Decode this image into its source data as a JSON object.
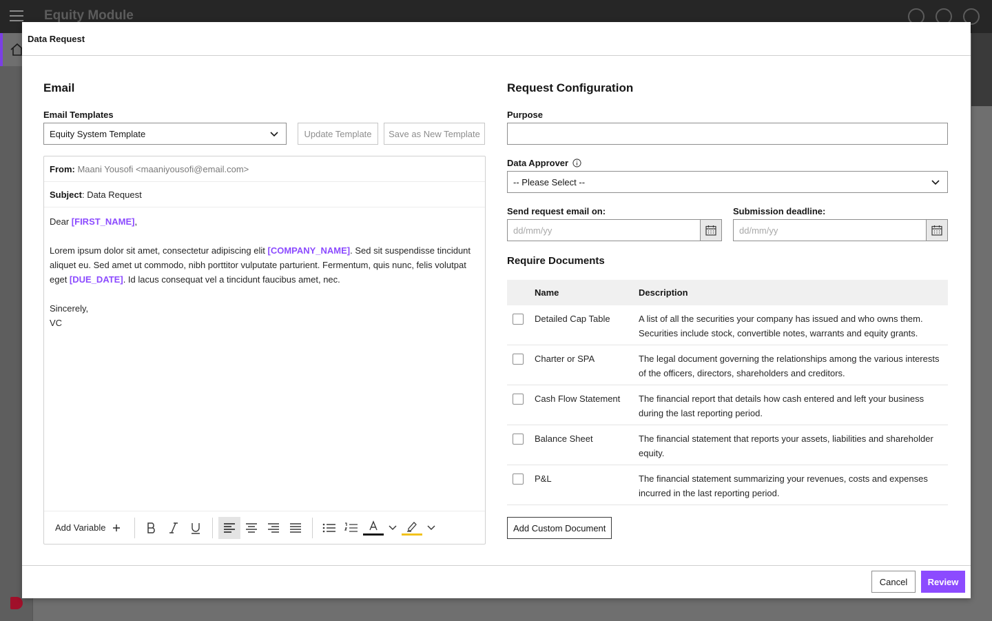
{
  "app": {
    "title": "Equity Module"
  },
  "modal": {
    "title": "Data Request",
    "cancel_label": "Cancel",
    "review_label": "Review"
  },
  "email": {
    "section_title": "Email",
    "templates_label": "Email Templates",
    "template_selected": "Equity System Template",
    "update_template_label": "Update Template",
    "save_template_label": "Save as New Template",
    "from_label": "From:",
    "from_value": "Maani Yousofi <maaniyousofi@email.com>",
    "subject_label": "Subject",
    "subject_value": ": Data Request",
    "greeting": "Dear ",
    "var_first_name": "[FIRST_NAME]",
    "greeting_end": ",",
    "body_part1": "Lorem ipsum dolor sit amet, consectetur adipiscing elit ",
    "var_company_name": "[COMPANY_NAME]",
    "body_part2": ". Sed sit suspendisse tincidunt aliquet eu. Sed amet ut commodo, nibh porttitor vulputate parturient. Fermentum, quis nunc, felis volutpat eget ",
    "var_due_date": "[DUE_DATE]",
    "body_part3": ". Id lacus consequat vel a tincidunt faucibus amet, nec.",
    "closing": "Sincerely,",
    "signature": "VC",
    "toolbar": {
      "add_variable_label": "Add Variable",
      "text_color": "#161616",
      "highlight_color": "#f1c21b"
    }
  },
  "config": {
    "section_title": "Request Configuration",
    "purpose_label": "Purpose",
    "purpose_value": "",
    "approver_label": "Data Approver",
    "approver_selected": "-- Please Select --",
    "send_on_label": "Send request email on:",
    "send_on_placeholder": "dd/mm/yy",
    "deadline_label": "Submission deadline:",
    "deadline_placeholder": "dd/mm/yy",
    "docs_title": "Require Documents",
    "col_name": "Name",
    "col_description": "Description",
    "documents": [
      {
        "name": "Detailed Cap Table",
        "description": "A list of all the securities your company has issued and who owns them. Securities include stock, convertible notes, warrants and equity grants."
      },
      {
        "name": "Charter or SPA",
        "description": "The legal document governing the relationships among the various interests of the officers, directors, shareholders and creditors."
      },
      {
        "name": "Cash Flow Statement",
        "description": "The financial report that details how cash entered and left your business during the last reporting period."
      },
      {
        "name": "Balance Sheet",
        "description": "The financial statement that reports your assets, liabilities and shareholder equity."
      },
      {
        "name": "P&L",
        "description": "The financial statement summarizing your revenues, costs and expenses incurred in the last reporting period."
      }
    ],
    "add_custom_label": "Add Custom Document"
  },
  "colors": {
    "accent": "#8c4bff",
    "header": "#262626"
  }
}
